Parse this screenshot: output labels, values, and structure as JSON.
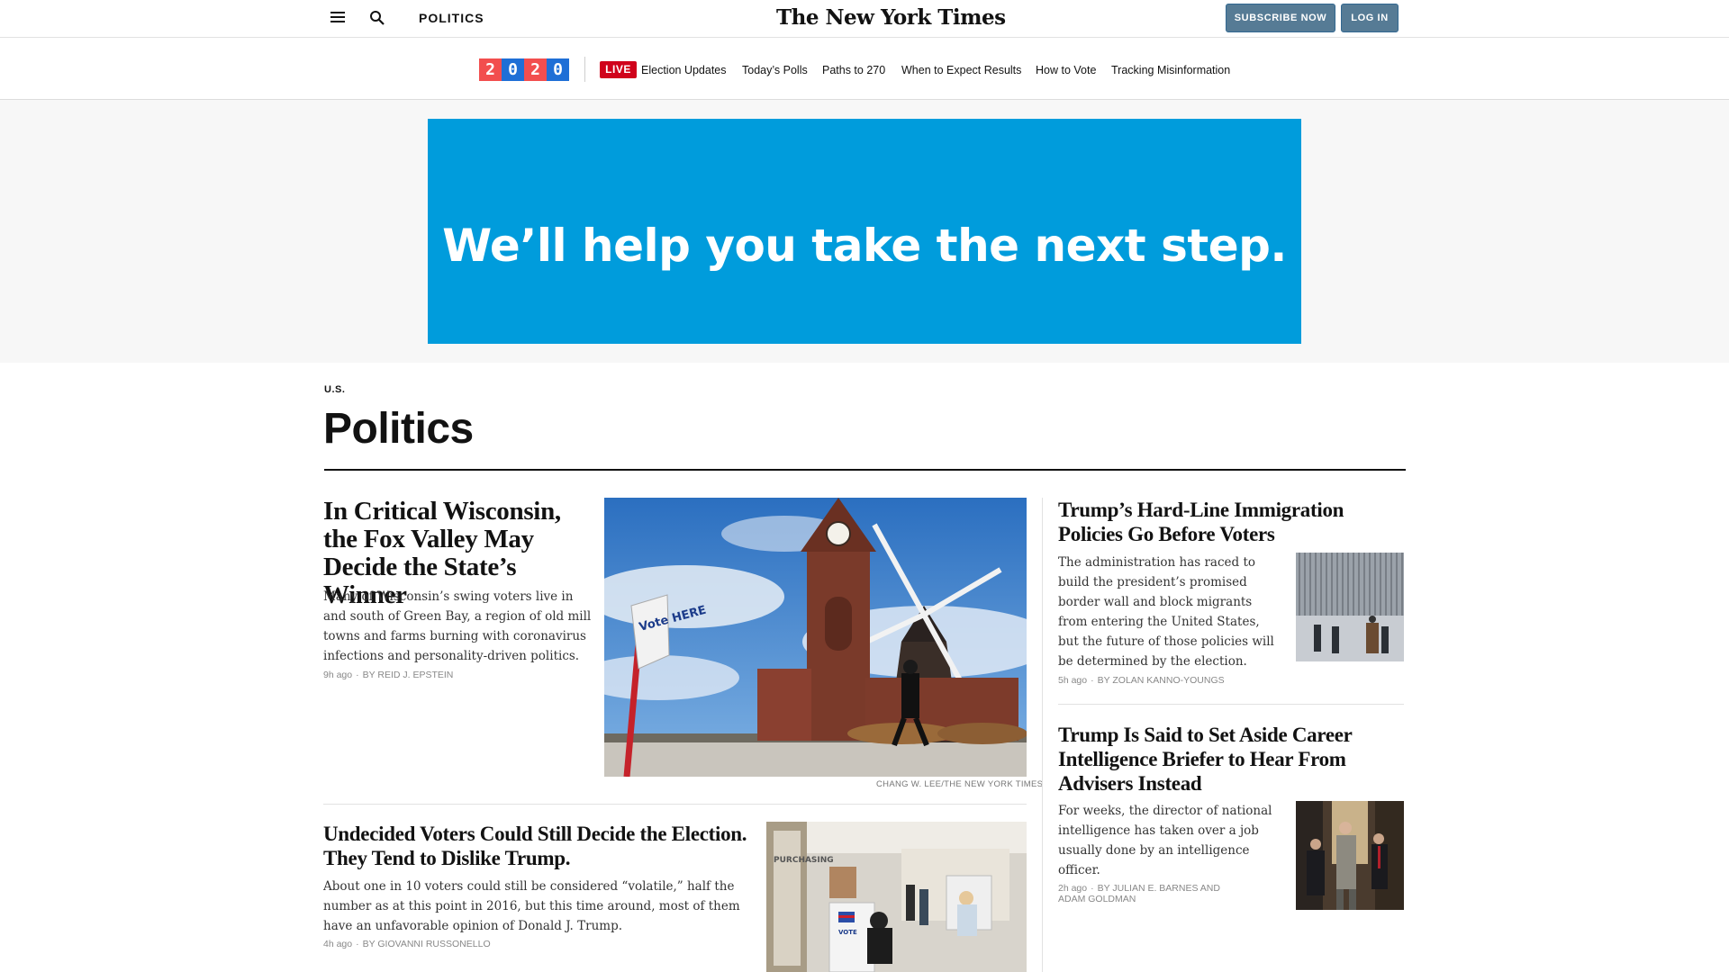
{
  "masthead": {
    "section": "POLITICS",
    "logo": "The New York Times",
    "subscribe_label": "SUBSCRIBE NOW",
    "login_label": "LOG IN"
  },
  "election_nav": {
    "badge_digits": [
      "2",
      "0",
      "2",
      "0"
    ],
    "live_label": "LIVE",
    "links": [
      "Election Updates",
      "Today’s Polls",
      "Paths to 270",
      "When to Expect Results",
      "How to Vote",
      "Tracking Misinformation"
    ]
  },
  "ad": {
    "text": "We’ll help you take the next step.",
    "background_color": "#009cdc"
  },
  "section_header": {
    "kicker": "U.S.",
    "title": "Politics"
  },
  "stories": [
    {
      "headline": "In Critical Wisconsin, the Fox Valley May Decide the State’s Winner",
      "summary": "Many of Wisconsin’s swing voters live in and south of Green Bay, a region of old mill towns and farms burning with coronavirus infections and personality-driven politics.",
      "time": "9h ago",
      "byline": "By REID J. EPSTEIN",
      "image_credit": "CHANG W. LEE/THE NEW YORK TIMES"
    },
    {
      "headline": "Undecided Voters Could Still Decide the Election. They Tend to Dislike Trump.",
      "summary": "About one in 10 voters could still be considered “volatile,” half the number as at this point in 2016, but this time around, most of them have an unfavorable opinion of Donald J. Trump.",
      "time": "4h ago",
      "byline": "By GIOVANNI RUSSONELLO"
    },
    {
      "headline": "Trump’s Hard-Line Immigration Policies Go Before Voters",
      "summary": "The administration has raced to build the president’s promised border wall and block migrants from entering the United States, but the future of those policies will be determined by the election.",
      "time": "5h ago",
      "byline": "By ZOLAN KANNO-YOUNGS"
    },
    {
      "headline": "Trump Is Said to Set Aside Career Intelligence Briefer to Hear From Advisers Instead",
      "summary": "For weeks, the director of national intelligence has taken over a job usually done by an intelligence officer.",
      "time": "2h ago",
      "byline": "By JULIAN E. BARNES and ADAM GOLDMAN"
    }
  ],
  "images": {
    "main_sign_text": "Vote HERE",
    "polls_sign_text": "PURCHASING",
    "booth_text": "VOTE"
  }
}
